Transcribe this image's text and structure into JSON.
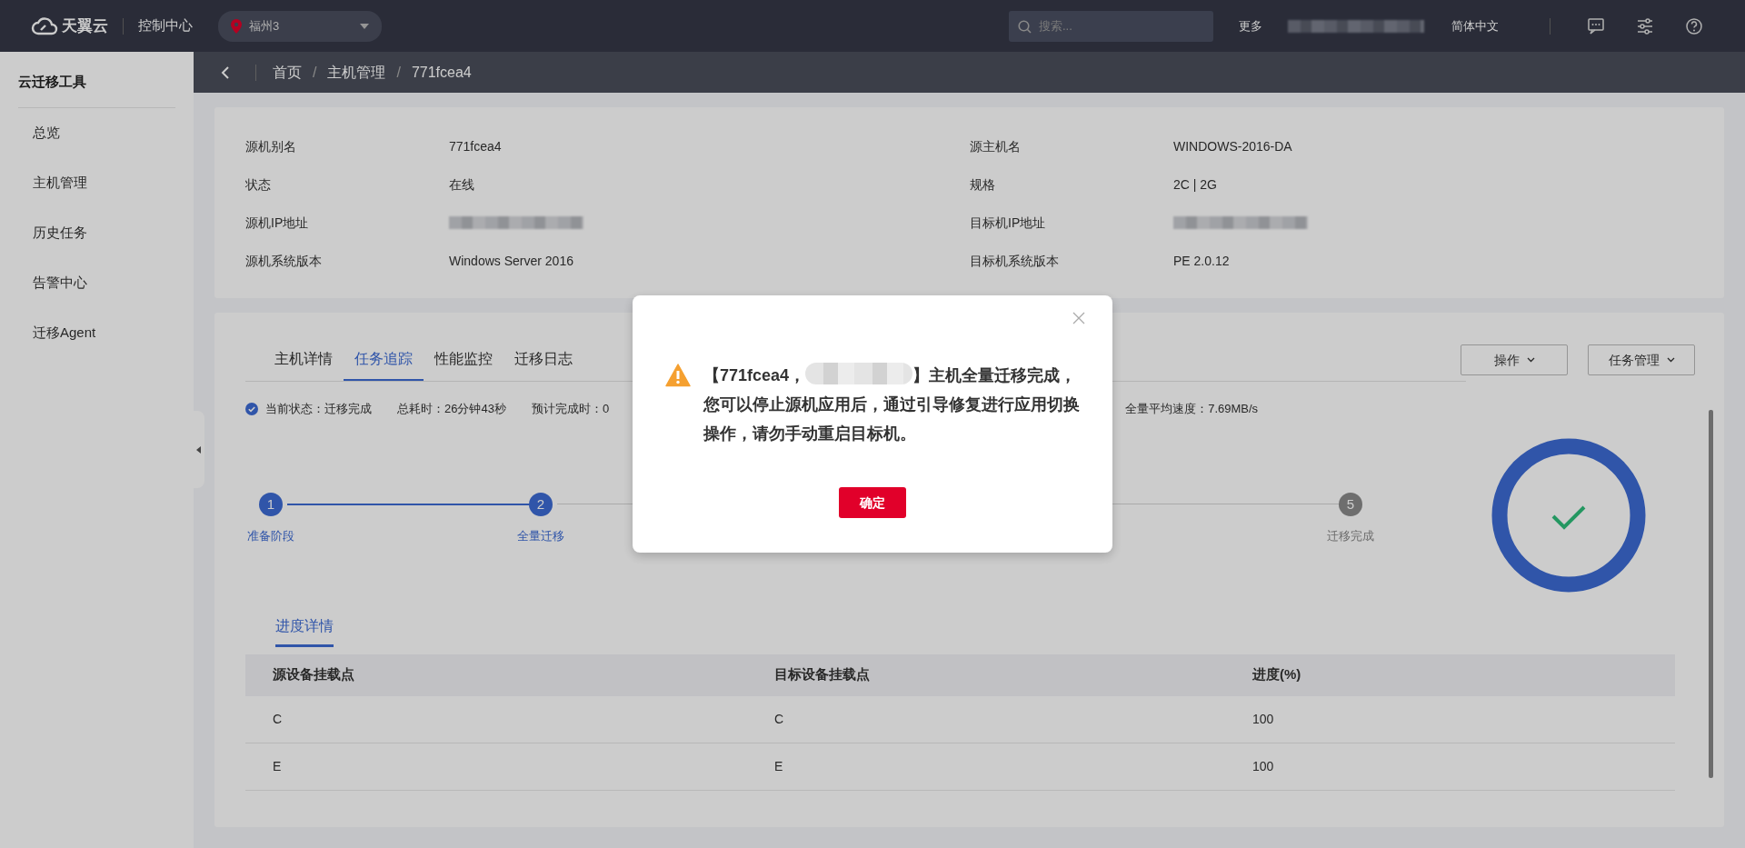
{
  "top_bar": {
    "brand": "天翼云",
    "console": "控制中心",
    "region": "福州3",
    "search": {
      "placeholder": "搜索..."
    },
    "more": "更多",
    "language": "简体中文"
  },
  "sidebar": {
    "title": "云迁移工具",
    "items": [
      "总览",
      "主机管理",
      "历史任务",
      "告警中心",
      "迁移Agent"
    ]
  },
  "breadcrumb": [
    "首页",
    "主机管理",
    "771fcea4"
  ],
  "breadcrumb_separator": "/",
  "host_info": [
    {
      "label": "源机别名",
      "value": "771fcea4",
      "kind": "text"
    },
    {
      "label": "源主机名",
      "value": "WINDOWS-2016-DA",
      "kind": "text"
    },
    {
      "label": "状态",
      "value": "在线",
      "kind": "text"
    },
    {
      "label": "规格",
      "value": "2C | 2G",
      "kind": "text"
    },
    {
      "label": "源机IP地址",
      "kind": "blurred"
    },
    {
      "label": "目标机IP地址",
      "kind": "blurred"
    },
    {
      "label": "源机系统版本",
      "value": "Windows Server 2016",
      "kind": "text"
    },
    {
      "label": "目标机系统版本",
      "value": "PE 2.0.12",
      "kind": "text"
    }
  ],
  "tabs": [
    {
      "label": "主机详情",
      "selected": false
    },
    {
      "label": "任务追踪",
      "selected": true
    },
    {
      "label": "性能监控",
      "selected": false
    },
    {
      "label": "迁移日志",
      "selected": false
    }
  ],
  "actions": [
    "操作",
    "任务管理"
  ],
  "status": {
    "state": "当前状态：迁移完成",
    "elapsed": "总耗时：26分钟43秒",
    "estimate": "预计完成时：0",
    "speed": "全量平均速度：7.69MB/s"
  },
  "steps": [
    {
      "number": "1",
      "label": "准备阶段",
      "done": true
    },
    {
      "number": "2",
      "label": "全量迁移",
      "done": true
    },
    {
      "number": "5",
      "label": "迁移完成",
      "done": false
    }
  ],
  "detail_tabs": [
    {
      "label": "进度详情",
      "selected": true
    }
  ],
  "table": {
    "columns": [
      "源设备挂载点",
      "目标设备挂载点",
      "进度(%)"
    ],
    "rows": [
      [
        "C",
        "C",
        "100"
      ],
      [
        "E",
        "E",
        "100"
      ]
    ]
  },
  "modal": {
    "message_before": "【771fcea4，",
    "message_after": "】主机全量迁移完成，您可以停止源机应用后，通过引导修复进行应用切换操作，请勿手动重启目标机。",
    "button": "确定"
  }
}
